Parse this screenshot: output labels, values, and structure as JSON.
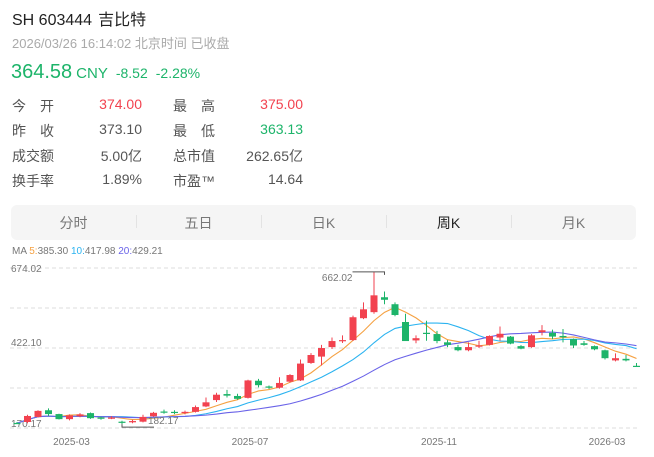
{
  "header": {
    "symbol": "SH 603444",
    "name": "吉比特",
    "timestamp": "2026/03/26 16:14:02 北京时间 已收盘"
  },
  "quote": {
    "price": "364.58",
    "currency": "CNY",
    "change": "-8.52",
    "change_pct": "-2.28%"
  },
  "stats": [
    {
      "label": "今　开",
      "value": "374.00",
      "tone": "red"
    },
    {
      "label": "最　高",
      "value": "375.00",
      "tone": "red"
    },
    {
      "label": "昨　收",
      "value": "373.10",
      "tone": ""
    },
    {
      "label": "最　低",
      "value": "363.13",
      "tone": "green"
    },
    {
      "label": "成交额",
      "value": "5.00亿",
      "tone": ""
    },
    {
      "label": "总市值",
      "value": "262.65亿",
      "tone": ""
    },
    {
      "label": "换手率",
      "value": "1.89%",
      "tone": ""
    },
    {
      "label": "市盈™",
      "value": "14.64",
      "tone": ""
    }
  ],
  "tabs": [
    {
      "label": "分时"
    },
    {
      "label": "五日"
    },
    {
      "label": "日K"
    },
    {
      "label": "周K",
      "active": true
    },
    {
      "label": "月K"
    }
  ],
  "ma_legend": {
    "prefix": "MA",
    "ma5_label": "5:",
    "ma5": "385.30",
    "ma10_label": "10:",
    "ma10": "417.98",
    "ma20_label": "20:",
    "ma20": "429.21"
  },
  "colors": {
    "up": "#f2424f",
    "down": "#1db46a",
    "ma5": "#f5a142",
    "ma10": "#2bb3f0",
    "ma20": "#6a63e8"
  },
  "chart_data": {
    "type": "candlestick",
    "period": "weekly",
    "y_ticks": [
      "674.02",
      "422.10",
      "170.17"
    ],
    "ylim": [
      170.17,
      674.02
    ],
    "x_labels": [
      {
        "index": 5,
        "label": "2025-03"
      },
      {
        "index": 22,
        "label": "2025-07"
      },
      {
        "index": 40,
        "label": "2025-11"
      },
      {
        "index": 56,
        "label": "2026-03"
      }
    ],
    "annotations": {
      "max": "662.02",
      "max_index": 35,
      "min": "182.17",
      "min_index": 10
    },
    "ohlc": [
      [
        186,
        185,
        189,
        183
      ],
      [
        189,
        208,
        212,
        185
      ],
      [
        205,
        224,
        226,
        203
      ],
      [
        226,
        214,
        232,
        208
      ],
      [
        214,
        198,
        215,
        197
      ],
      [
        198,
        210,
        213,
        194
      ],
      [
        207,
        213,
        217,
        204
      ],
      [
        217,
        201,
        219,
        199
      ],
      [
        203,
        200,
        206,
        196
      ],
      [
        200,
        203,
        207,
        198
      ],
      [
        190,
        187,
        193,
        182.17
      ],
      [
        188,
        192,
        196,
        185
      ],
      [
        190,
        205,
        212,
        188
      ],
      [
        207,
        218,
        221,
        205
      ],
      [
        222,
        219,
        228,
        215
      ],
      [
        221,
        218,
        226,
        214
      ],
      [
        217,
        221,
        225,
        213
      ],
      [
        221,
        236,
        241,
        219
      ],
      [
        238,
        251,
        266,
        236
      ],
      [
        258,
        275,
        281,
        252
      ],
      [
        277,
        272,
        290,
        266
      ],
      [
        271,
        262,
        278,
        259
      ],
      [
        265,
        320,
        322,
        263
      ],
      [
        319,
        305,
        325,
        298
      ],
      [
        301,
        297,
        304,
        293
      ],
      [
        297,
        312,
        330,
        294
      ],
      [
        316,
        337,
        340,
        313
      ],
      [
        320,
        373,
        386,
        318
      ],
      [
        375,
        400,
        406,
        372
      ],
      [
        395,
        422,
        432,
        367
      ],
      [
        425,
        444,
        455,
        419
      ],
      [
        444,
        447,
        462,
        438
      ],
      [
        447,
        519,
        524,
        444
      ],
      [
        516,
        544,
        566,
        513
      ],
      [
        535,
        588,
        662.02,
        530
      ],
      [
        582,
        574,
        600,
        560
      ],
      [
        560,
        526,
        566,
        522
      ],
      [
        504,
        444,
        530,
        444
      ],
      [
        446,
        453,
        462,
        437
      ],
      [
        470,
        468,
        508,
        445
      ],
      [
        466,
        444,
        476,
        437
      ],
      [
        440,
        432,
        447,
        425
      ],
      [
        425,
        415,
        432,
        412
      ],
      [
        415,
        425,
        440,
        412
      ],
      [
        427,
        430,
        445,
        422
      ],
      [
        432,
        460,
        462,
        430
      ],
      [
        455,
        467,
        490,
        445
      ],
      [
        458,
        436,
        460,
        434
      ],
      [
        428,
        420,
        431,
        418
      ],
      [
        425,
        462,
        466,
        423
      ],
      [
        472,
        478,
        494,
        462
      ],
      [
        470,
        458,
        480,
        450
      ],
      [
        460,
        456,
        482,
        440
      ],
      [
        450,
        430,
        452,
        422
      ],
      [
        437,
        432,
        444,
        429
      ],
      [
        428,
        418,
        430,
        415
      ],
      [
        415,
        390,
        417,
        386
      ],
      [
        383,
        390,
        405,
        380
      ],
      [
        388,
        383,
        400,
        380
      ],
      [
        366,
        364.58,
        375,
        363.13
      ]
    ]
  }
}
